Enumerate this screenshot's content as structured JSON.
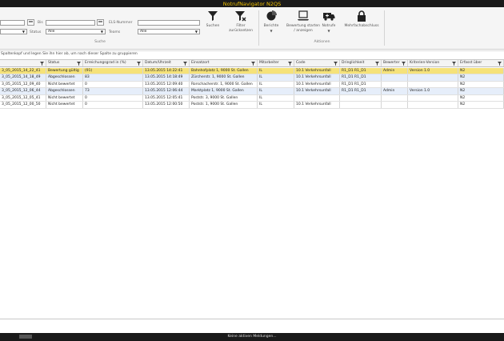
{
  "app": {
    "title": "NotrufNavigator N2QS"
  },
  "filters": {
    "bis_label": "Bis",
    "status_label": "Status",
    "status_value": "Alle",
    "els_label": "ELS-Nummer",
    "teams_label": "Teams",
    "teams_value": "Alle",
    "group_label": "Suche"
  },
  "ribbon": {
    "suchen": "Suchen",
    "filter_zuruecksetzen": "Filter zurücksetzen",
    "berichte": "Berichte",
    "bewertung": "Bewertung starten / anzeigen",
    "notrufe": "Notrufe",
    "mehrfach": "Mehrfachabschluss",
    "aktionen_label": "Aktionen"
  },
  "hint": "Spaltenkopf und legen Sie ihn hier ab, um nach dieser Spalte zu gruppieren",
  "table": {
    "headers": [
      "",
      "Status",
      "Erreichungsgrad in (%)",
      "Datum/Uhrzeit",
      "Einsatzort",
      "Mitarbeiter",
      "Code",
      "Dringlichkeit",
      "Bewerter",
      "Kriterien-Version",
      "Erfasst über"
    ],
    "rows": [
      [
        "3_05_2015_14_22_41",
        "Bewertung gültig",
        "(91)",
        "13.05.2015 14:22:41",
        "Bahnhofplatz 1, 9000 St. Gallen",
        "IL",
        "10.1 Verkehrsunfall",
        "R1_D1 R1_D1",
        "Admin",
        "Version 1.0",
        "N2"
      ],
      [
        "3_05_2015_14_18_49",
        "Abgeschlossen",
        "83",
        "13.05.2015 14:18:49",
        "Zürcherstr. 1, 9000 St. Gallen",
        "IL",
        "10.1 Verkehrsunfall",
        "R1_D1 R1_D1",
        "",
        "",
        "N2"
      ],
      [
        "3_05_2015_12_09_40",
        "Nicht bewertet",
        "0",
        "13.05.2015 12:09:40",
        "Rorschacherstr. 1, 9000 St. Gallen",
        "IL",
        "10.1 Verkehrsunfall",
        "R1_D1 R1_D1",
        "",
        "",
        "N2"
      ],
      [
        "3_05_2015_12_06_44",
        "Abgeschlossen",
        "73",
        "13.05.2015 12:06:44",
        "Marktplatz 1, 9000 St. Gallen",
        "IL",
        "10.1 Verkehrsunfall",
        "R1_D1 R1_D1",
        "Admin",
        "Version 1.0",
        "N2"
      ],
      [
        "3_05_2015_12_05_41",
        "Nicht bewertet",
        "0",
        "13.05.2015 12:05:41",
        "Poststr. 3, 9000 St. Gallen",
        "IL",
        "",
        "",
        "",
        "",
        "N2"
      ],
      [
        "3_05_2015_12_00_50",
        "Nicht bewertet",
        "0",
        "13.05.2015 12:00:50",
        "Poststr. 1, 9000 St. Gallen",
        "IL",
        "10.1 Verkehrsunfall",
        "",
        "",
        "",
        "N2"
      ]
    ]
  },
  "statusbar": {
    "message": "Keine aktiven Meldungen..."
  },
  "colors": {
    "accent": "#f0c000",
    "selected_row": "#f5e27a",
    "alt_row": "#e6eefa",
    "titlebar": "#1a1a1a"
  }
}
